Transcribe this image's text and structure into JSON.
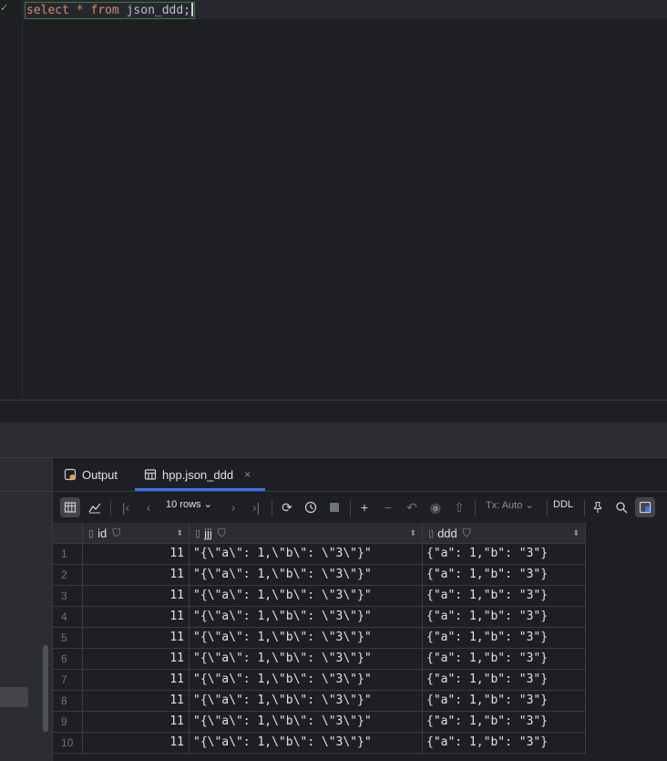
{
  "editor": {
    "status_mark": "✓",
    "keyword_select": "select",
    "star": "*",
    "keyword_from": "from",
    "table": "json_ddd",
    "semicolon": ";"
  },
  "tabs": {
    "output_label": "Output",
    "table_label": "hpp.json_ddd",
    "close_glyph": "×"
  },
  "toolbar": {
    "rows_label": "10 rows",
    "tx_label": "Tx: Auto",
    "ddl_label": "DDL"
  },
  "columns": [
    "id",
    "jjj",
    "ddd"
  ],
  "rows": [
    {
      "n": "1",
      "id": "11",
      "jjj": "\"{\\\"a\\\": 1,\\\"b\\\": \\\"3\\\"}\"",
      "ddd": "{\"a\": 1,\"b\": \"3\"}"
    },
    {
      "n": "2",
      "id": "11",
      "jjj": "\"{\\\"a\\\": 1,\\\"b\\\": \\\"3\\\"}\"",
      "ddd": "{\"a\": 1,\"b\": \"3\"}"
    },
    {
      "n": "3",
      "id": "11",
      "jjj": "\"{\\\"a\\\": 1,\\\"b\\\": \\\"3\\\"}\"",
      "ddd": "{\"a\": 1,\"b\": \"3\"}"
    },
    {
      "n": "4",
      "id": "11",
      "jjj": "\"{\\\"a\\\": 1,\\\"b\\\": \\\"3\\\"}\"",
      "ddd": "{\"a\": 1,\"b\": \"3\"}"
    },
    {
      "n": "5",
      "id": "11",
      "jjj": "\"{\\\"a\\\": 1,\\\"b\\\": \\\"3\\\"}\"",
      "ddd": "{\"a\": 1,\"b\": \"3\"}"
    },
    {
      "n": "6",
      "id": "11",
      "jjj": "\"{\\\"a\\\": 1,\\\"b\\\": \\\"3\\\"}\"",
      "ddd": "{\"a\": 1,\"b\": \"3\"}"
    },
    {
      "n": "7",
      "id": "11",
      "jjj": "\"{\\\"a\\\": 1,\\\"b\\\": \\\"3\\\"}\"",
      "ddd": "{\"a\": 1,\"b\": \"3\"}"
    },
    {
      "n": "8",
      "id": "11",
      "jjj": "\"{\\\"a\\\": 1,\\\"b\\\": \\\"3\\\"}\"",
      "ddd": "{\"a\": 1,\"b\": \"3\"}"
    },
    {
      "n": "9",
      "id": "11",
      "jjj": "\"{\\\"a\\\": 1,\\\"b\\\": \\\"3\\\"}\"",
      "ddd": "{\"a\": 1,\"b\": \"3\"}"
    },
    {
      "n": "10",
      "id": "11",
      "jjj": "\"{\\\"a\\\": 1,\\\"b\\\": \\\"3\\\"}\"",
      "ddd": "{\"a\": 1,\"b\": \"3\"}"
    }
  ],
  "icons": {
    "grid": "table-view-icon",
    "chart": "chart-view-icon",
    "first": "first-page-icon",
    "prev": "prev-page-icon",
    "next": "next-page-icon",
    "last": "last-page-icon",
    "refresh": "refresh-icon",
    "history": "history-icon",
    "stop": "stop-icon",
    "add": "add-row-icon",
    "remove": "remove-row-icon",
    "revert": "revert-icon",
    "preview": "preview-icon",
    "submit": "submit-icon",
    "pin": "pin-icon",
    "search": "search-icon",
    "layout": "layout-icon"
  },
  "colors": {
    "accent": "#3574f0",
    "keyword": "#cf8e6d",
    "ok": "#5fb865"
  }
}
